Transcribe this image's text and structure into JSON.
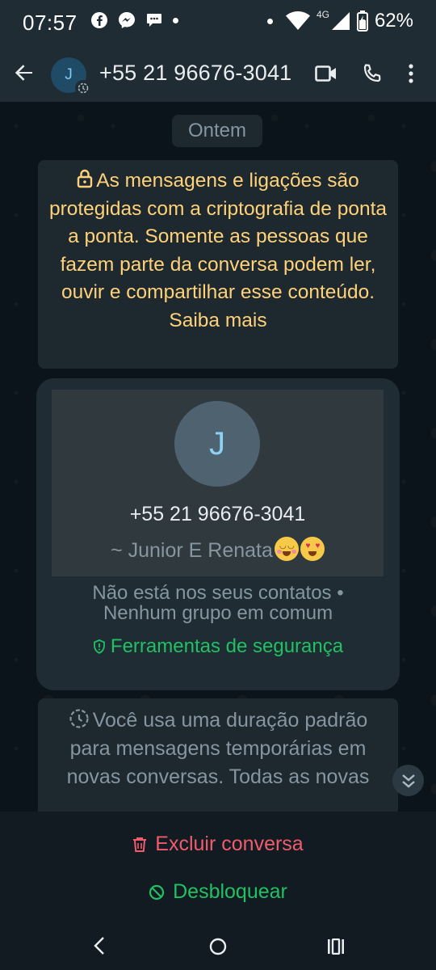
{
  "status_bar": {
    "time": "07:57",
    "network": "4G",
    "battery": "62%"
  },
  "header": {
    "avatar_letter": "J",
    "title": "+55 21 96676-3041"
  },
  "chat": {
    "date_chip": "Ontem",
    "encryption_notice": "As mensagens e ligações são protegidas com a criptografia de ponta a ponta. Somente as pessoas que fazem parte da conversa podem ler, ouvir e compartilhar esse conteúdo. Saiba mais",
    "contact_card": {
      "avatar_letter": "J",
      "phone": "+55 21 96676-3041",
      "push_name": "~ Junior E Renata",
      "not_in_contacts": "Não está nos seus contatos •",
      "no_common_groups": "Nenhum grupo em comum",
      "security_tools": "Ferramentas de segurança"
    },
    "disappearing_notice": "Você usa uma duração padrão para mensagens temporárias em novas conversas. Todas as novas"
  },
  "actions": {
    "delete_chat": "Excluir conversa",
    "unblock": "Desbloquear"
  },
  "colors": {
    "header_bg": "#1f2c34",
    "chat_bg": "#0b141a",
    "system_text": "#ffd279",
    "green": "#21c063",
    "red": "#f15c6d"
  }
}
